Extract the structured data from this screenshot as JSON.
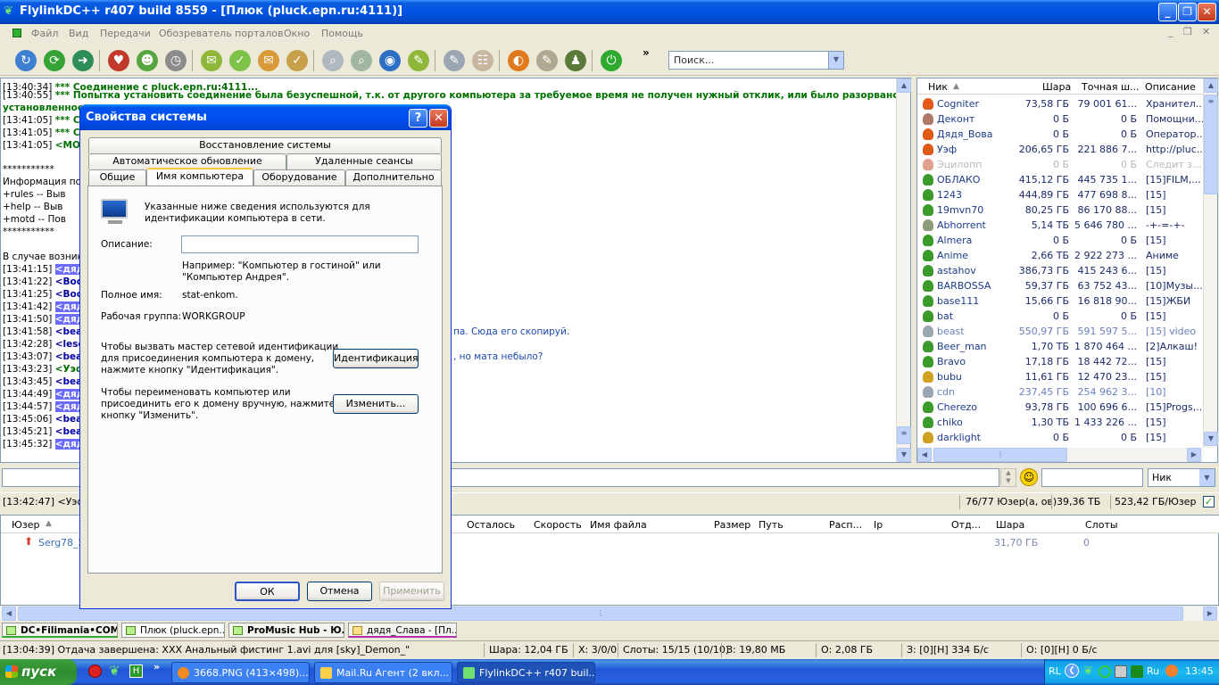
{
  "window": {
    "title": "FlylinkDC++ r407 build 8559 - [Плюк (pluck.epn.ru:4111)]"
  },
  "menu": [
    "Файл",
    "Вид",
    "Передачи",
    "Обозреватель порталов",
    "Окно",
    "Помощь"
  ],
  "toolbar": {
    "search_placeholder": "Поиск..."
  },
  "chat": {
    "lines": [
      {
        "ts": "[13:40:34]",
        "text": "*** Соединение с pluck.epn.ru:4111..."
      },
      {
        "ts": "[13:40:55]",
        "text": "*** Попытка установить соединение была безуспешной, т.к. от другого компьютера за требуемое время не получен нужный отклик, или было разорвано уже"
      },
      {
        "ts": "",
        "text": "установленное"
      },
      {
        "ts": "[13:41:05]",
        "text": "*** Сое"
      },
      {
        "ts": "[13:41:05]",
        "text": "*** Сое"
      },
      {
        "ts": "[13:41:05]",
        "text": "<MOTD"
      },
      {
        "ts": "",
        "text": "***********"
      },
      {
        "ts": "",
        "text": "Информация по"
      },
      {
        "ts": "",
        "text": "+rules     -- Выв"
      },
      {
        "ts": "",
        "text": "+help      -- Выв"
      },
      {
        "ts": "",
        "text": "+motd     -- Пов"
      },
      {
        "ts": "",
        "text": "***********"
      },
      {
        "ts": "",
        "text": "В случае возник"
      },
      {
        "ts": "[13:41:15]",
        "nick": "<дядя"
      },
      {
        "ts": "[13:41:22]",
        "nick": "<Вось"
      },
      {
        "ts": "[13:41:25]",
        "nick": "<Вось"
      },
      {
        "ts": "[13:41:42]",
        "nick": "<дядя"
      },
      {
        "ts": "[13:41:50]",
        "nick": "<дядя"
      },
      {
        "ts": "[13:41:58]",
        "nick": "<beast"
      },
      {
        "ts": "[13:42:28]",
        "nick": "<lesca"
      },
      {
        "ts": "[13:43:07]",
        "nick": "<beast"
      },
      {
        "ts": "[13:43:23]",
        "nick": "<Уэф>"
      },
      {
        "ts": "[13:43:45]",
        "nick": "<beast"
      },
      {
        "ts": "[13:44:49]",
        "nick": "<дядя"
      },
      {
        "ts": "[13:44:57]",
        "nick": "<дядя"
      },
      {
        "ts": "[13:45:06]",
        "nick": "<beast"
      },
      {
        "ts": "[13:45:21]",
        "nick": "<beast"
      },
      {
        "ts": "[13:45:32]",
        "nick": "<дядя"
      }
    ],
    "fragment_1": "па. Сюда его скопируй.",
    "fragment_2": ", но мата небыло?"
  },
  "userlist": {
    "columns": [
      "Ник",
      "Шара",
      "Точная ш...",
      "Описание"
    ],
    "rows": [
      {
        "nick": "Cogniter",
        "share": "73,58 ГБ",
        "exact": "79 001 61...",
        "desc": "Хранител...",
        "status": "op"
      },
      {
        "nick": "Деконт",
        "share": "0 Б",
        "exact": "0 Б",
        "desc": "Помощни...",
        "status": "op-grey"
      },
      {
        "nick": "Дядя_Вова",
        "share": "0 Б",
        "exact": "0 Б",
        "desc": "Оператор...",
        "status": "op"
      },
      {
        "nick": "Уэф",
        "share": "206,65 ГБ",
        "exact": "221 886 7...",
        "desc": "http://pluc...",
        "status": "op"
      },
      {
        "nick": "Эцилопп",
        "share": "0 Б",
        "exact": "0 Б",
        "desc": "Следит з...",
        "status": "away"
      },
      {
        "nick": "ОБЛАКО",
        "share": "415,12 ГБ",
        "exact": "445 735 1...",
        "desc": "[15]FILM,...",
        "status": "user"
      },
      {
        "nick": "1243",
        "share": "444,89 ГБ",
        "exact": "477 698 8...",
        "desc": "[15]",
        "status": "user"
      },
      {
        "nick": "19mvn70",
        "share": "80,25 ГБ",
        "exact": "86 170 88...",
        "desc": "[15]",
        "status": "user"
      },
      {
        "nick": "Abhorrent",
        "share": "5,14 ТБ",
        "exact": "5 646 780 ...",
        "desc": "-+-=-+-",
        "status": "user-grey"
      },
      {
        "nick": "Almera",
        "share": "0 Б",
        "exact": "0 Б",
        "desc": "[15]",
        "status": "user"
      },
      {
        "nick": "Anime",
        "share": "2,66 ТБ",
        "exact": "2 922 273 ...",
        "desc": "Аниме",
        "status": "user"
      },
      {
        "nick": "astahov",
        "share": "386,73 ГБ",
        "exact": "415 243 6...",
        "desc": "[15]",
        "status": "user"
      },
      {
        "nick": "BARBOSSA",
        "share": "59,37 ГБ",
        "exact": "63 752 43...",
        "desc": "[10]Музы...",
        "status": "user"
      },
      {
        "nick": "base111",
        "share": "15,66 ГБ",
        "exact": "16 818 90...",
        "desc": "[15]ЖБИ",
        "status": "user"
      },
      {
        "nick": "bat",
        "share": "0 Б",
        "exact": "0 Б",
        "desc": "[15]",
        "status": "user"
      },
      {
        "nick": "beast",
        "share": "550,97 ГБ",
        "exact": "591 597 5...",
        "desc": "[15] video",
        "status": "server"
      },
      {
        "nick": "Beer_man",
        "share": "1,70 ТБ",
        "exact": "1 870 464 ...",
        "desc": "[2]Алкаш!",
        "status": "user"
      },
      {
        "nick": "Bravo",
        "share": "17,18 ГБ",
        "exact": "18 442 72...",
        "desc": "[15]",
        "status": "user"
      },
      {
        "nick": "bubu",
        "share": "11,61 ГБ",
        "exact": "12 470 23...",
        "desc": "[15]",
        "status": "user-key"
      },
      {
        "nick": "cdn",
        "share": "237,45 ГБ",
        "exact": "254 962 3...",
        "desc": "[10]",
        "status": "server"
      },
      {
        "nick": "Cherezo",
        "share": "93,78 ГБ",
        "exact": "100 696 6...",
        "desc": "[15]Progs,...",
        "status": "user"
      },
      {
        "nick": "chiko",
        "share": "1,30 ТБ",
        "exact": "1 433 226 ...",
        "desc": "[15]",
        "status": "user"
      },
      {
        "nick": "darklight",
        "share": "0 Б",
        "exact": "0 Б",
        "desc": "[15]",
        "status": "user-key"
      }
    ]
  },
  "input": {
    "nick_filter": "Ник"
  },
  "statusline": {
    "last_message": "[13:42:47] <Уэф>",
    "users": "76/77 Юзер(а, ов)",
    "total_share": "39,36 ТБ",
    "per_user": "523,42 ГБ/Юзер"
  },
  "transfers": {
    "columns": [
      "Юзер",
      "Осталось",
      "Скорость",
      "Имя файла",
      "Размер",
      "Путь",
      "Расп...",
      "Ip",
      "Отд...",
      "Шара",
      "Слоты"
    ],
    "rows": [
      {
        "user": "Serg78_2",
        "share": "31,70 ГБ",
        "slots": "0"
      }
    ]
  },
  "hub_tabs": [
    {
      "label": "DC•Filimania•COM..."
    },
    {
      "label": "Плюк (pluck.epn...."
    },
    {
      "label": "ProMusic Hub - Ю..."
    },
    {
      "label": "дядя_Слава - [Пл..."
    }
  ],
  "statusbar": {
    "message": "[13:04:39] Отдача завершена: XXX Анальный фистинг 1.avi для [sky]_Demon_\"",
    "share": "Шара: 12,04 ГБ",
    "hubs": "Х: 3/0/0",
    "slots": "Слоты: 15/15 (10/10)",
    "downloaded": "З: 19,80 МБ",
    "uploaded": "О: 2,08 ГБ",
    "down_speed": "З: [0][Н] 334 Б/с",
    "up_speed": "О: [0][Н] 0 Б/с"
  },
  "taskbar": {
    "start": "пуск",
    "tasks": [
      {
        "label": "3668.PNG (413×498)..."
      },
      {
        "label": "Mail.Ru Агент (2 вкл..."
      },
      {
        "label": "FlylinkDC++ r407 buil..."
      }
    ],
    "lang": "RL",
    "clock": "13:45",
    "lang2": "Ru"
  },
  "dialog": {
    "title": "Свойства системы",
    "tabs_row1": [
      "Восстановление системы"
    ],
    "tabs_row2": [
      "Автоматическое обновление",
      "Удаленные сеансы"
    ],
    "tabs_row3": [
      "Общие",
      "Имя компьютера",
      "Оборудование",
      "Дополнительно"
    ],
    "intro": [
      "Указанные ниже сведения используются для",
      "идентификации компьютера в сети."
    ],
    "description_label": "Описание:",
    "description_value": "",
    "example": [
      "Например: \"Компьютер в гостиной\" или",
      "\"Компьютер Андрея\"."
    ],
    "fullname_label": "Полное имя:",
    "fullname_value": "stat-enkom.",
    "workgroup_label": "Рабочая группа:",
    "workgroup_value": "WORKGROUP",
    "wizard_text": [
      "Чтобы вызвать мастер сетевой идентификации",
      "для присоединения компьютера к домену,",
      "нажмите кнопку \"Идентификация\"."
    ],
    "identify_button": "Идентификация",
    "rename_text": [
      "Чтобы переименовать компьютер или",
      "присоединить его к домену вручную, нажмите",
      "кнопку \"Изменить\"."
    ],
    "change_button": "Изменить...",
    "ok": "ОК",
    "cancel": "Отмена",
    "apply": "Применить",
    "help_glyph": "?",
    "close_glyph": "✕"
  }
}
